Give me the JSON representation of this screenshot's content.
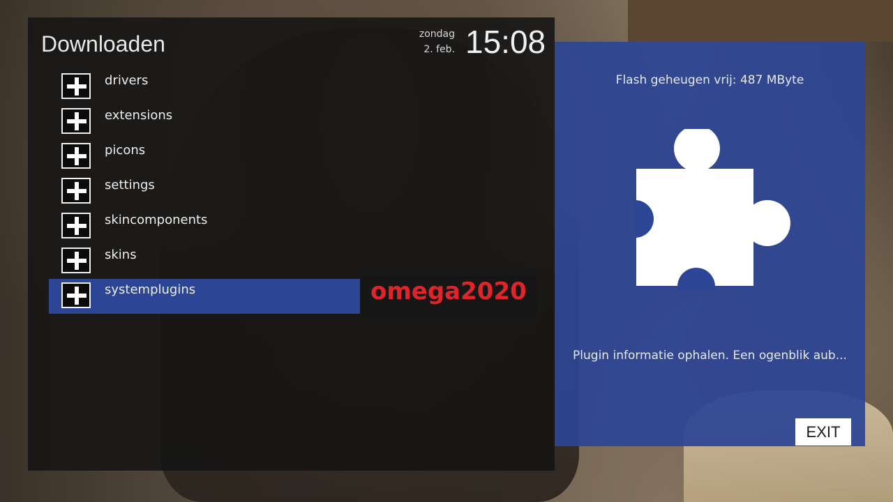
{
  "screen": {
    "title": "Downloaden",
    "day": "zondag",
    "date": "2. feb.",
    "time": "15:08"
  },
  "list": {
    "items": [
      {
        "label": "drivers",
        "icon": "plus-icon"
      },
      {
        "label": "extensions",
        "icon": "plus-icon"
      },
      {
        "label": "picons",
        "icon": "plus-icon"
      },
      {
        "label": "settings",
        "icon": "plus-icon"
      },
      {
        "label": "skincomponents",
        "icon": "plus-icon"
      },
      {
        "label": "skins",
        "icon": "plus-icon"
      },
      {
        "label": "systemplugins",
        "icon": "plus-icon",
        "selected": true
      }
    ]
  },
  "watermark": "omega2020",
  "info_panel": {
    "flash_memory": "Flash geheugen vrij: 487 MByte",
    "icon": "puzzle-piece-icon",
    "status": "Plugin informatie ophalen. Een ogenblik aub...",
    "exit_label": "EXIT"
  },
  "colors": {
    "selection": "#2c4595",
    "info_panel": "#2c4595",
    "watermark": "#e0242a"
  }
}
